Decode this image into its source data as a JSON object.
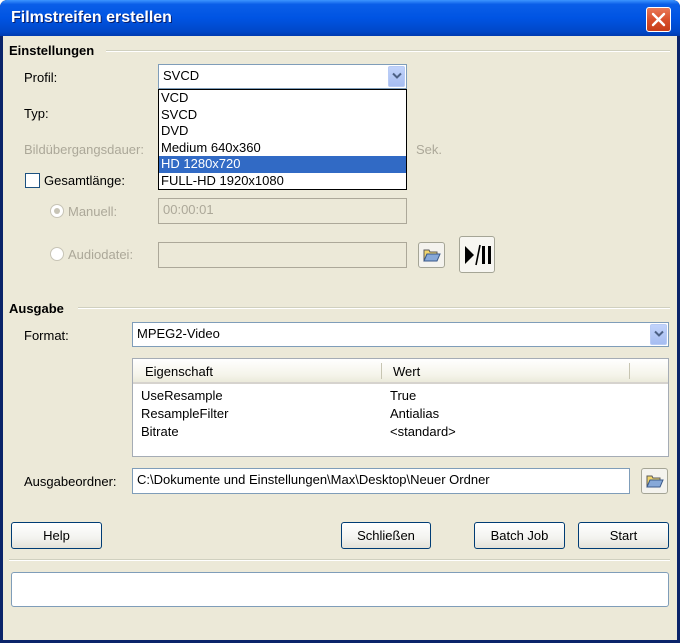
{
  "window": {
    "title": "Filmstreifen erstellen"
  },
  "settings": {
    "section_title": "Einstellungen",
    "profile_label": "Profil:",
    "profile_value": "SVCD",
    "profile_options": [
      "VCD",
      "SVCD",
      "DVD",
      "Medium 640x360",
      "HD 1280x720",
      "FULL-HD 1920x1080"
    ],
    "profile_highlighted": "HD 1280x720",
    "type_label": "Typ:",
    "transition_label": "Bildübergangsdauer:",
    "transition_unit": "Sek.",
    "total_length_label": "Gesamtlänge:",
    "total_length_checked": false,
    "manual_label": "Manuell:",
    "manual_value": "00:00:01",
    "manual_selected": true,
    "audio_label": "Audiodatei:",
    "audio_value": "",
    "browse_audio_icon": "folder-open-icon",
    "play_pause_icon": "play-pause-icon"
  },
  "output": {
    "section_title": "Ausgabe",
    "format_label": "Format:",
    "format_value": "MPEG2-Video",
    "properties": {
      "columns": [
        "Eigenschaft",
        "Wert"
      ],
      "rows": [
        [
          "UseResample",
          "True"
        ],
        [
          "ResampleFilter",
          "Antialias"
        ],
        [
          "Bitrate",
          "<standard>"
        ]
      ]
    },
    "folder_label": "Ausgabeordner:",
    "folder_value": "C:\\Dokumente und Einstellungen\\Max\\Desktop\\Neuer Ordner",
    "browse_folder_icon": "folder-open-icon"
  },
  "buttons": {
    "help": "Help",
    "close": "Schließen",
    "batch": "Batch Job",
    "start": "Start"
  },
  "status_text": "",
  "colors": {
    "titlebar": "#0054e3",
    "dialog_bg": "#ece9d8",
    "selection": "#316ac5",
    "close_button": "#d9502c"
  }
}
